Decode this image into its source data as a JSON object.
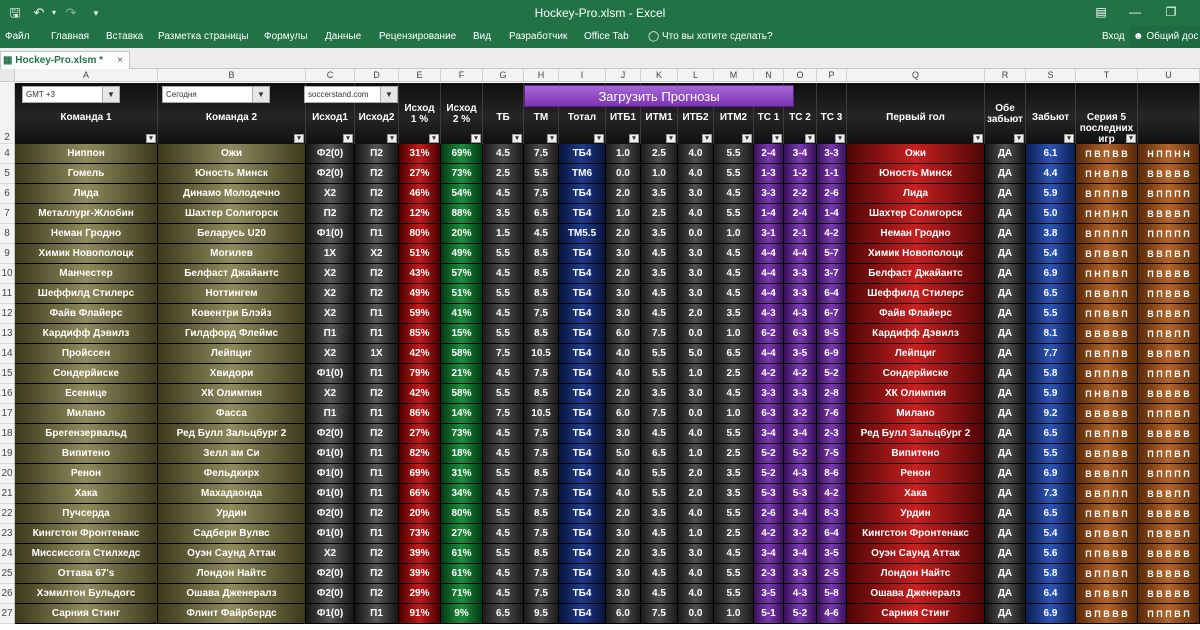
{
  "window": {
    "title": "Hockey-Pro.xlsm - Excel",
    "quick_access": [
      "save-icon",
      "undo-icon",
      "redo-icon",
      "customize-icon"
    ]
  },
  "ribbon": {
    "tabs": [
      "Файл",
      "Главная",
      "Вставка",
      "Разметка страницы",
      "Формулы",
      "Данные",
      "Рецензирование",
      "Вид",
      "Разработчик",
      "Office Tab"
    ],
    "tell_me": "Что вы хотите сделать?",
    "signin": "Вход",
    "share": "Общий дос"
  },
  "doc_tab": {
    "label": "Hockey-Pro.xlsm *",
    "close": "×"
  },
  "sheet": {
    "columns": [
      "A",
      "B",
      "C",
      "D",
      "E",
      "F",
      "G",
      "H",
      "I",
      "J",
      "K",
      "L",
      "M",
      "N",
      "O",
      "P",
      "Q",
      "R",
      "S",
      "T",
      "U"
    ],
    "dropdowns": [
      {
        "value": "GMT +3"
      },
      {
        "value": "Сегодня"
      },
      {
        "value": "soccerstand.com"
      }
    ],
    "load_button": "Загрузить Прогнозы",
    "headers": [
      "Команда 1",
      "Команда 2",
      "Исход1",
      "Исход2",
      "Исход 1 %",
      "Исход 2 %",
      "ТБ",
      "ТМ",
      "Тотал",
      "ИТБ1",
      "ИТМ1",
      "ИТБ2",
      "ИТМ2",
      "ТС 1",
      "ТС 2",
      "ТС 3",
      "Первый гол",
      "Обе забьют",
      "Забьют",
      "Серия 5 последних игр",
      ""
    ],
    "header_row_number": "2",
    "rows": [
      {
        "n": "4",
        "cells": [
          "Ниппон",
          "Ожи",
          "Ф2(0)",
          "П2",
          "31%",
          "69%",
          "4.5",
          "7.5",
          "ТБ4",
          "1.0",
          "2.5",
          "4.0",
          "5.5",
          "2-4",
          "3-4",
          "3-3",
          "Ожи",
          "ДА",
          "6.1",
          "П В П В В",
          "Н П П Н Н"
        ]
      },
      {
        "n": "5",
        "cells": [
          "Гомель",
          "Юность Минск",
          "Ф2(0)",
          "П2",
          "27%",
          "73%",
          "2.5",
          "5.5",
          "ТМ6",
          "0.0",
          "1.0",
          "4.0",
          "5.5",
          "1-3",
          "1-2",
          "1-1",
          "Юность Минск",
          "ДА",
          "4.4",
          "П Н В П В",
          "В В В В В"
        ]
      },
      {
        "n": "6",
        "cells": [
          "Лида",
          "Динамо Молодечно",
          "Х2",
          "П2",
          "46%",
          "54%",
          "4.5",
          "7.5",
          "ТБ4",
          "2.0",
          "3.5",
          "3.0",
          "4.5",
          "3-3",
          "2-2",
          "2-6",
          "Лида",
          "ДА",
          "5.9",
          "В П П П В",
          "В П П П П"
        ]
      },
      {
        "n": "7",
        "cells": [
          "Металлург-Жлобин",
          "Шахтер Солигорск",
          "П2",
          "П2",
          "12%",
          "88%",
          "3.5",
          "6.5",
          "ТБ4",
          "1.0",
          "2.5",
          "4.0",
          "5.5",
          "1-4",
          "2-4",
          "1-4",
          "Шахтер Солигорск",
          "ДА",
          "5.0",
          "П Н П Н П",
          "В В В В П"
        ]
      },
      {
        "n": "8",
        "cells": [
          "Неман Гродно",
          "Беларусь U20",
          "Ф1(0)",
          "П1",
          "80%",
          "20%",
          "1.5",
          "4.5",
          "ТМ5.5",
          "2.0",
          "3.5",
          "0.0",
          "1.0",
          "3-1",
          "2-1",
          "4-2",
          "Неман Гродно",
          "ДА",
          "3.8",
          "В П П П П",
          "П П П П П"
        ]
      },
      {
        "n": "9",
        "cells": [
          "Химик Новополоцк",
          "Могилев",
          "1Х",
          "Х2",
          "51%",
          "49%",
          "5.5",
          "8.5",
          "ТБ4",
          "3.0",
          "4.5",
          "3.0",
          "4.5",
          "4-4",
          "4-4",
          "5-7",
          "Химик Новополоцк",
          "ДА",
          "5.4",
          "В П В В П",
          "В В П В П"
        ]
      },
      {
        "n": "10",
        "cells": [
          "Манчестер",
          "Белфаст Джайантс",
          "Х2",
          "П2",
          "43%",
          "57%",
          "4.5",
          "8.5",
          "ТБ4",
          "2.0",
          "3.5",
          "3.0",
          "4.5",
          "4-4",
          "3-3",
          "3-7",
          "Белфаст Джайантс",
          "ДА",
          "6.9",
          "П Н П В П",
          "П В В В В"
        ]
      },
      {
        "n": "11",
        "cells": [
          "Шеффилд Стилерс",
          "Ноттингем",
          "Х2",
          "П2",
          "49%",
          "51%",
          "5.5",
          "8.5",
          "ТБ4",
          "3.0",
          "4.5",
          "3.0",
          "4.5",
          "4-4",
          "3-3",
          "6-4",
          "Шеффилд Стилерс",
          "ДА",
          "6.5",
          "П В В П П",
          "П П В В В"
        ]
      },
      {
        "n": "12",
        "cells": [
          "Файв Флайерс",
          "Ковентри Блэйз",
          "Х2",
          "П1",
          "59%",
          "41%",
          "4.5",
          "7.5",
          "ТБ4",
          "3.0",
          "4.5",
          "2.0",
          "3.5",
          "4-3",
          "4-3",
          "6-7",
          "Файв Флайерс",
          "ДА",
          "5.5",
          "П П В В П",
          "В П В В П"
        ]
      },
      {
        "n": "13",
        "cells": [
          "Кардифф Дэвилз",
          "Гилдфорд Флеймс",
          "П1",
          "П1",
          "85%",
          "15%",
          "5.5",
          "8.5",
          "ТБ4",
          "6.0",
          "7.5",
          "0.0",
          "1.0",
          "6-2",
          "6-3",
          "9-5",
          "Кардифф Дэвилз",
          "ДА",
          "8.1",
          "В В В В В",
          "П П В П П"
        ]
      },
      {
        "n": "14",
        "cells": [
          "Пройссен",
          "Лейпциг",
          "Х2",
          "1Х",
          "42%",
          "58%",
          "7.5",
          "10.5",
          "ТБ4",
          "4.0",
          "5.5",
          "5.0",
          "6.5",
          "4-4",
          "3-5",
          "6-9",
          "Лейпциг",
          "ДА",
          "7.7",
          "П В П П В",
          "В В П В П"
        ]
      },
      {
        "n": "15",
        "cells": [
          "Сондерйиске",
          "Хвидори",
          "Ф1(0)",
          "П1",
          "79%",
          "21%",
          "4.5",
          "7.5",
          "ТБ4",
          "4.0",
          "5.5",
          "1.0",
          "2.5",
          "4-2",
          "4-2",
          "5-2",
          "Сондерйиске",
          "ДА",
          "5.8",
          "В П П П В",
          "П П П В П"
        ]
      },
      {
        "n": "16",
        "cells": [
          "Есенице",
          "ХК Олимпия",
          "Х2",
          "П2",
          "42%",
          "58%",
          "5.5",
          "8.5",
          "ТБ4",
          "2.0",
          "3.5",
          "3.0",
          "4.5",
          "3-3",
          "3-3",
          "2-8",
          "ХК Олимпия",
          "ДА",
          "5.9",
          "П Н В П В",
          "В В В В В"
        ]
      },
      {
        "n": "17",
        "cells": [
          "Милано",
          "Фасса",
          "П1",
          "П1",
          "86%",
          "14%",
          "7.5",
          "10.5",
          "ТБ4",
          "6.0",
          "7.5",
          "0.0",
          "1.0",
          "6-3",
          "3-2",
          "7-6",
          "Милано",
          "ДА",
          "9.2",
          "В В В В В",
          "П П П В П"
        ]
      },
      {
        "n": "18",
        "cells": [
          "Брегензервальд",
          "Ред Булл Зальцбург 2",
          "Ф2(0)",
          "П2",
          "27%",
          "73%",
          "4.5",
          "7.5",
          "ТБ4",
          "3.0",
          "4.5",
          "4.0",
          "5.5",
          "3-4",
          "3-4",
          "2-3",
          "Ред Булл Зальцбург 2",
          "ДА",
          "6.5",
          "П В П П В",
          "В В В В В"
        ]
      },
      {
        "n": "19",
        "cells": [
          "Випитено",
          "Зелл ам Си",
          "Ф1(0)",
          "П1",
          "82%",
          "18%",
          "4.5",
          "7.5",
          "ТБ4",
          "5.0",
          "6.5",
          "1.0",
          "2.5",
          "5-2",
          "5-2",
          "7-5",
          "Випитено",
          "ДА",
          "5.5",
          "В В П В В",
          "П П П В П"
        ]
      },
      {
        "n": "20",
        "cells": [
          "Ренон",
          "Фельдкирх",
          "Ф1(0)",
          "П1",
          "69%",
          "31%",
          "5.5",
          "8.5",
          "ТБ4",
          "4.0",
          "5.5",
          "2.0",
          "3.5",
          "5-2",
          "4-3",
          "8-6",
          "Ренон",
          "ДА",
          "6.9",
          "В В В П П",
          "В П П П П"
        ]
      },
      {
        "n": "21",
        "cells": [
          "Хака",
          "Махадаонда",
          "Ф1(0)",
          "П1",
          "66%",
          "34%",
          "4.5",
          "7.5",
          "ТБ4",
          "4.0",
          "5.5",
          "2.0",
          "3.5",
          "5-3",
          "5-3",
          "4-2",
          "Хака",
          "ДА",
          "7.3",
          "В В П П П",
          "В В В П П"
        ]
      },
      {
        "n": "22",
        "cells": [
          "Пучсерда",
          "Урдин",
          "Ф2(0)",
          "П2",
          "20%",
          "80%",
          "5.5",
          "8.5",
          "ТБ4",
          "2.0",
          "3.5",
          "4.0",
          "5.5",
          "2-6",
          "3-4",
          "8-3",
          "Урдин",
          "ДА",
          "6.5",
          "П В П В П",
          "В В В В В"
        ]
      },
      {
        "n": "23",
        "cells": [
          "Кингстон Фронтенакс",
          "Садбери Вулвс",
          "Ф1(0)",
          "П1",
          "73%",
          "27%",
          "4.5",
          "7.5",
          "ТБ4",
          "3.0",
          "4.5",
          "1.0",
          "2.5",
          "4-2",
          "3-2",
          "6-4",
          "Кингстон Фронтенакс",
          "ДА",
          "5.4",
          "В П В В П",
          "П В В В П"
        ]
      },
      {
        "n": "24",
        "cells": [
          "Миссиссога Стилхедс",
          "Оуэн Саунд Аттак",
          "Х2",
          "П2",
          "39%",
          "61%",
          "5.5",
          "8.5",
          "ТБ4",
          "2.0",
          "3.5",
          "3.0",
          "4.5",
          "3-4",
          "3-4",
          "3-5",
          "Оуэн Саунд Аттак",
          "ДА",
          "5.6",
          "П П В В В",
          "В В В В В"
        ]
      },
      {
        "n": "25",
        "cells": [
          "Оттава 67's",
          "Лондон Найтс",
          "Ф2(0)",
          "П2",
          "39%",
          "61%",
          "4.5",
          "7.5",
          "ТБ4",
          "3.0",
          "4.5",
          "4.0",
          "5.5",
          "2-3",
          "3-3",
          "2-5",
          "Лондон Найтс",
          "ДА",
          "5.8",
          "В П П В П",
          "В В В В В"
        ]
      },
      {
        "n": "26",
        "cells": [
          "Хэмилтон Бульдогс",
          "Ошава Дженералз",
          "Ф2(0)",
          "П2",
          "29%",
          "71%",
          "4.5",
          "7.5",
          "ТБ4",
          "3.0",
          "4.5",
          "4.0",
          "5.5",
          "3-5",
          "4-3",
          "5-8",
          "Ошава Дженералз",
          "ДА",
          "6.4",
          "В П В В П",
          "В В В В В"
        ]
      },
      {
        "n": "27",
        "cells": [
          "Сарния Стинг",
          "Флинт Файрбердс",
          "Ф1(0)",
          "П1",
          "91%",
          "9%",
          "6.5",
          "9.5",
          "ТБ4",
          "6.0",
          "7.5",
          "0.0",
          "1.0",
          "5-1",
          "5-2",
          "4-6",
          "Сарния Стинг",
          "ДА",
          "6.9",
          "В П В В В",
          "П П П В П"
        ]
      }
    ]
  }
}
